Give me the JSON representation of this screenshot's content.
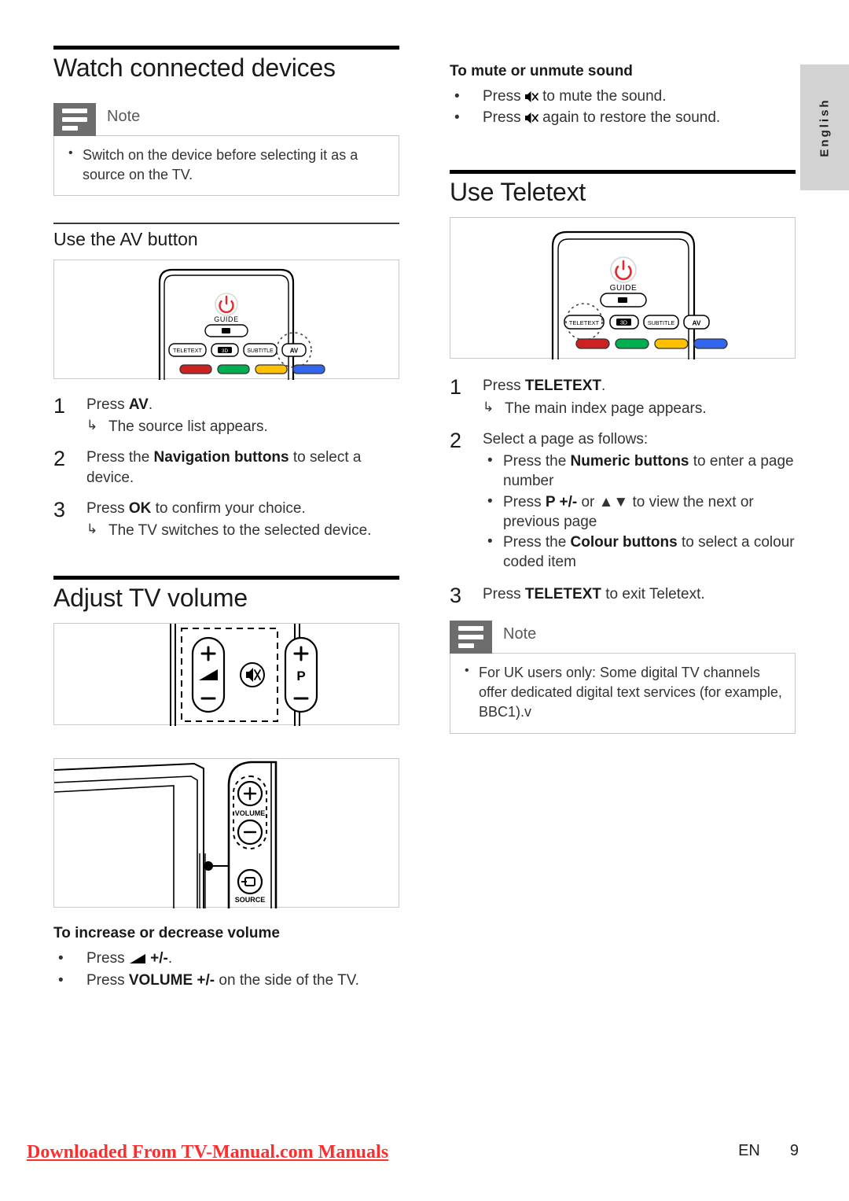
{
  "language_tab": {
    "label": "English"
  },
  "left_column": {
    "heading": "Watch connected devices",
    "note": {
      "title": "Note",
      "items": [
        "Switch on the device before selecting it as a source on the TV."
      ]
    },
    "subheading_av": "Use the AV button",
    "remote_figure": {
      "name": "remote-control-av",
      "power_label": "",
      "guide_label": "GUIDE",
      "buttons": [
        "TELETEXT",
        "3D",
        "SUBTITLE",
        "AV"
      ],
      "highlighted_button": "AV",
      "colour_buttons": [
        "red",
        "green",
        "yellow",
        "blue"
      ]
    },
    "steps_av": [
      {
        "num": "1",
        "text_parts": [
          {
            "t": "Press ",
            "b": false
          },
          {
            "t": "AV",
            "b": true
          },
          {
            "t": ".",
            "b": false
          }
        ],
        "result": "The source list appears."
      },
      {
        "num": "2",
        "text_parts": [
          {
            "t": "Press the ",
            "b": false
          },
          {
            "t": "Navigation buttons",
            "b": true
          },
          {
            "t": " to select a device.",
            "b": false
          }
        ],
        "result": ""
      },
      {
        "num": "3",
        "text_parts": [
          {
            "t": "Press ",
            "b": false
          },
          {
            "t": "OK",
            "b": true
          },
          {
            "t": " to confirm your choice.",
            "b": false
          }
        ],
        "result": "The TV switches to the selected device."
      }
    ],
    "heading_volume": "Adjust TV volume",
    "volume_remote_figure": {
      "name": "remote-volume-rocker",
      "volume_plus": "+",
      "volume_minus": "−",
      "program_label": "P",
      "program_plus": "+",
      "program_minus": "−"
    },
    "tv_side_figure": {
      "name": "tv-side-panel",
      "volume_label": "VOLUME",
      "source_label": "SOURCE"
    },
    "subheading_increase": "To increase or decrease volume",
    "volume_bullets": [
      [
        {
          "t": "Press ",
          "b": false
        },
        {
          "t": "GLYPH_VOLUME",
          "b": false
        },
        {
          "t": " +/-",
          "b": true
        },
        {
          "t": ".",
          "b": false
        }
      ],
      [
        {
          "t": "Press ",
          "b": false
        },
        {
          "t": "VOLUME +/-",
          "b": true
        },
        {
          "t": " on the side of the TV.",
          "b": false
        }
      ]
    ]
  },
  "right_column": {
    "subheading_mute": "To mute or unmute sound",
    "mute_bullets": [
      [
        {
          "t": "Press ",
          "b": false
        },
        {
          "t": "GLYPH_MUTE",
          "b": false
        },
        {
          "t": " to mute the sound.",
          "b": false
        }
      ],
      [
        {
          "t": "Press ",
          "b": false
        },
        {
          "t": "GLYPH_MUTE",
          "b": false
        },
        {
          "t": " again to restore the sound.",
          "b": false
        }
      ]
    ],
    "heading": "Use Teletext",
    "remote_figure": {
      "name": "remote-control-teletext",
      "guide_label": "GUIDE",
      "buttons": [
        "TELETEXT",
        "3D",
        "SUBTITLE",
        "AV"
      ],
      "highlighted_button": "TELETEXT",
      "colour_buttons": [
        "red",
        "green",
        "yellow",
        "blue"
      ]
    },
    "steps_teletext": [
      {
        "num": "1",
        "text_parts": [
          {
            "t": "Press ",
            "b": false
          },
          {
            "t": "TELETEXT",
            "b": true
          },
          {
            "t": ".",
            "b": false
          }
        ],
        "result": "The main index page appears."
      },
      {
        "num": "2",
        "text_parts": [
          {
            "t": "Select a page as follows:",
            "b": false
          }
        ],
        "sub_bullets": [
          [
            {
              "t": "Press the ",
              "b": false
            },
            {
              "t": "Numeric buttons",
              "b": true
            },
            {
              "t": " to enter a page number",
              "b": false
            }
          ],
          [
            {
              "t": "Press ",
              "b": false
            },
            {
              "t": "P +/-",
              "b": true
            },
            {
              "t": " or ",
              "b": false
            },
            {
              "t": "▲▼",
              "b": false
            },
            {
              "t": " to view the next or previous page",
              "b": false
            }
          ],
          [
            {
              "t": "Press the ",
              "b": false
            },
            {
              "t": "Colour buttons",
              "b": true
            },
            {
              "t": " to select a colour coded item",
              "b": false
            }
          ]
        ]
      },
      {
        "num": "3",
        "text_parts": [
          {
            "t": "Press ",
            "b": false
          },
          {
            "t": "TELETEXT",
            "b": true
          },
          {
            "t": " to exit Teletext.",
            "b": false
          }
        ]
      }
    ],
    "note": {
      "title": "Note",
      "items": [
        "For UK users only: Some digital TV channels offer dedicated digital text services (for example, BBC1).v"
      ]
    }
  },
  "footer": {
    "watermark": "Downloaded From TV-Manual.com Manuals",
    "language_code": "EN",
    "page_number": "9"
  },
  "colors": {
    "red_button": "#cc2222",
    "green_button": "#00b050",
    "yellow_button": "#ffc000",
    "blue_button": "#3366ee",
    "power_red": "#e8262b",
    "note_icon_bg": "#6d6d6d",
    "lang_tab_bg": "#d2d2d2",
    "watermark": "#ff2d2d"
  }
}
